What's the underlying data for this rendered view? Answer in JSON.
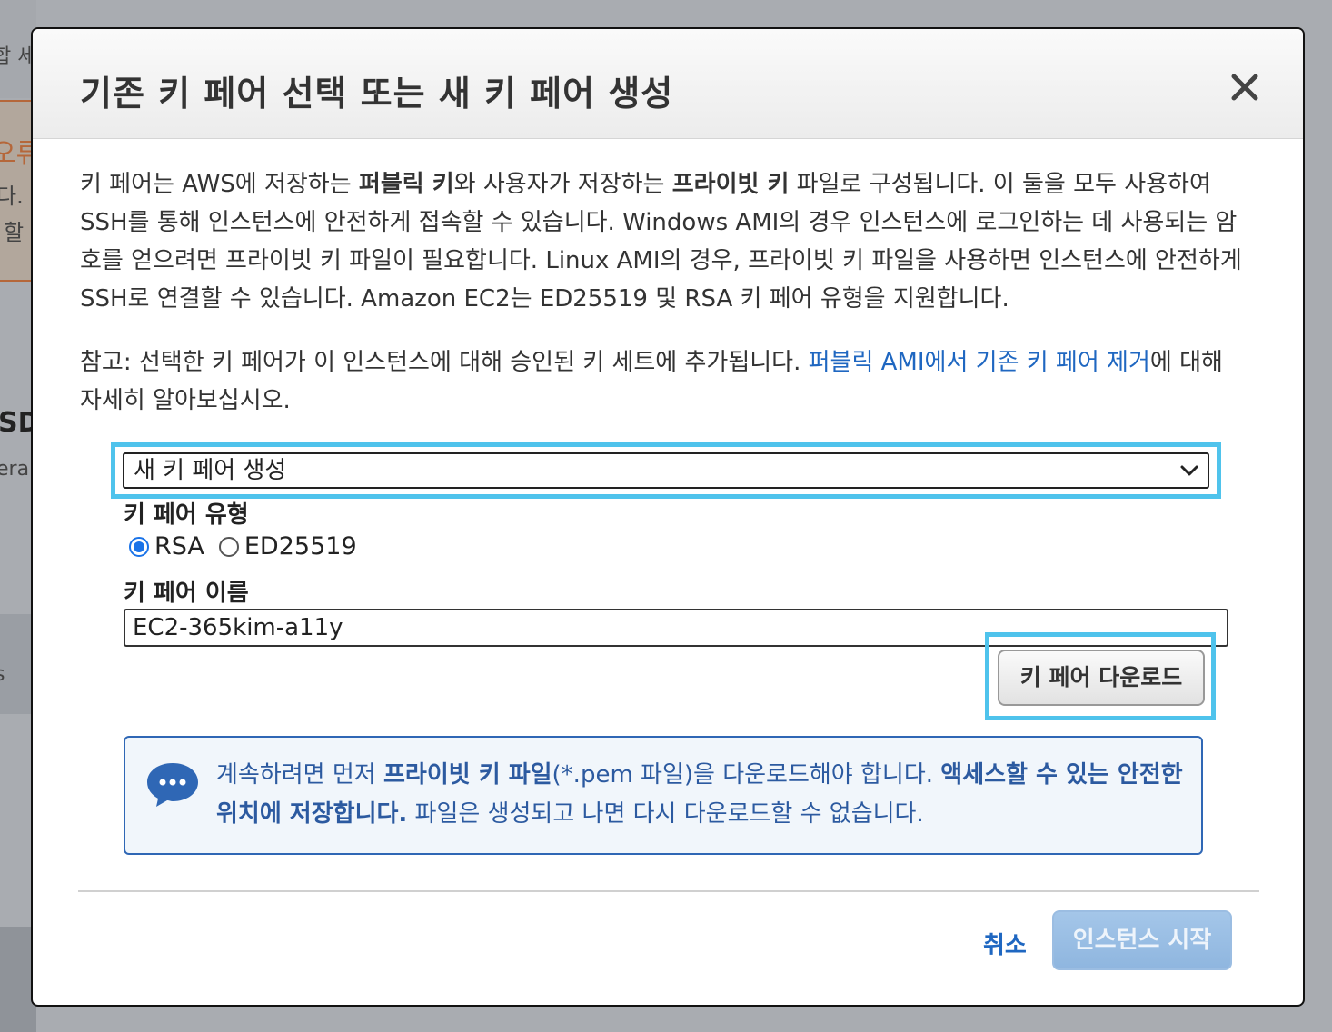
{
  "background": {
    "fragments": [
      "합 세",
      "오류",
      "다. ",
      "할",
      "SD",
      "era",
      "s"
    ]
  },
  "modal": {
    "title": "기존 키 페어 선택 또는 새 키 페어 생성",
    "close_icon": "close-icon",
    "description": {
      "p1_a": "키 페어는 AWS에 저장하는 ",
      "p1_b": "퍼블릭 키",
      "p1_c": "와 사용자가 저장하는 ",
      "p1_d": "프라이빗 키",
      "p1_e": " 파일로 구성됩니다. 이 둘을 모두 사용하여 SSH를 통해 인스턴스에 안전하게 접속할 수 있습니다. Windows AMI의 경우 인스턴스에 로그인하는 데 사용되는 암호를 얻으려면 프라이빗 키 파일이 필요합니다. Linux AMI의 경우, 프라이빗 키 파일을 사용하면 인스턴스에 안전하게 SSH로 연결할 수 있습니다. Amazon EC2는 ED25519 및 RSA 키 페어 유형을 지원합니다."
    },
    "note": {
      "a": "참고: 선택한 키 페어가 이 인스턴스에 대해 승인된 키 세트에 추가됩니다. ",
      "link": "퍼블릭 AMI에서 기존 키 페어 제거",
      "b": "에 대해 자세히 알아보십시오."
    },
    "key_select": {
      "selected": "새 키 페어 생성"
    },
    "key_type": {
      "label": "키 페어 유형",
      "options": [
        "RSA",
        "ED25519"
      ],
      "selected": "RSA"
    },
    "key_name": {
      "label": "키 페어 이름",
      "value": "EC2-365kim-a11y"
    },
    "download_button": "키 페어 다운로드",
    "info": {
      "a": "계속하려면 먼저 ",
      "b": "프라이빗 키 파일",
      "c": "(*.pem 파일)을 다운로드해야 합니다. ",
      "d": "액세스할 수 있는 안전한 위치에 저장합니다.",
      "e": " 파일은 생성되고 나면 다시 다운로드할 수 없습니다."
    },
    "footer": {
      "cancel": "취소",
      "launch": "인스턴스 시작"
    }
  },
  "colors": {
    "link": "#1f67c1",
    "highlight": "#4fc3ec",
    "info_border": "#2f67b5"
  }
}
